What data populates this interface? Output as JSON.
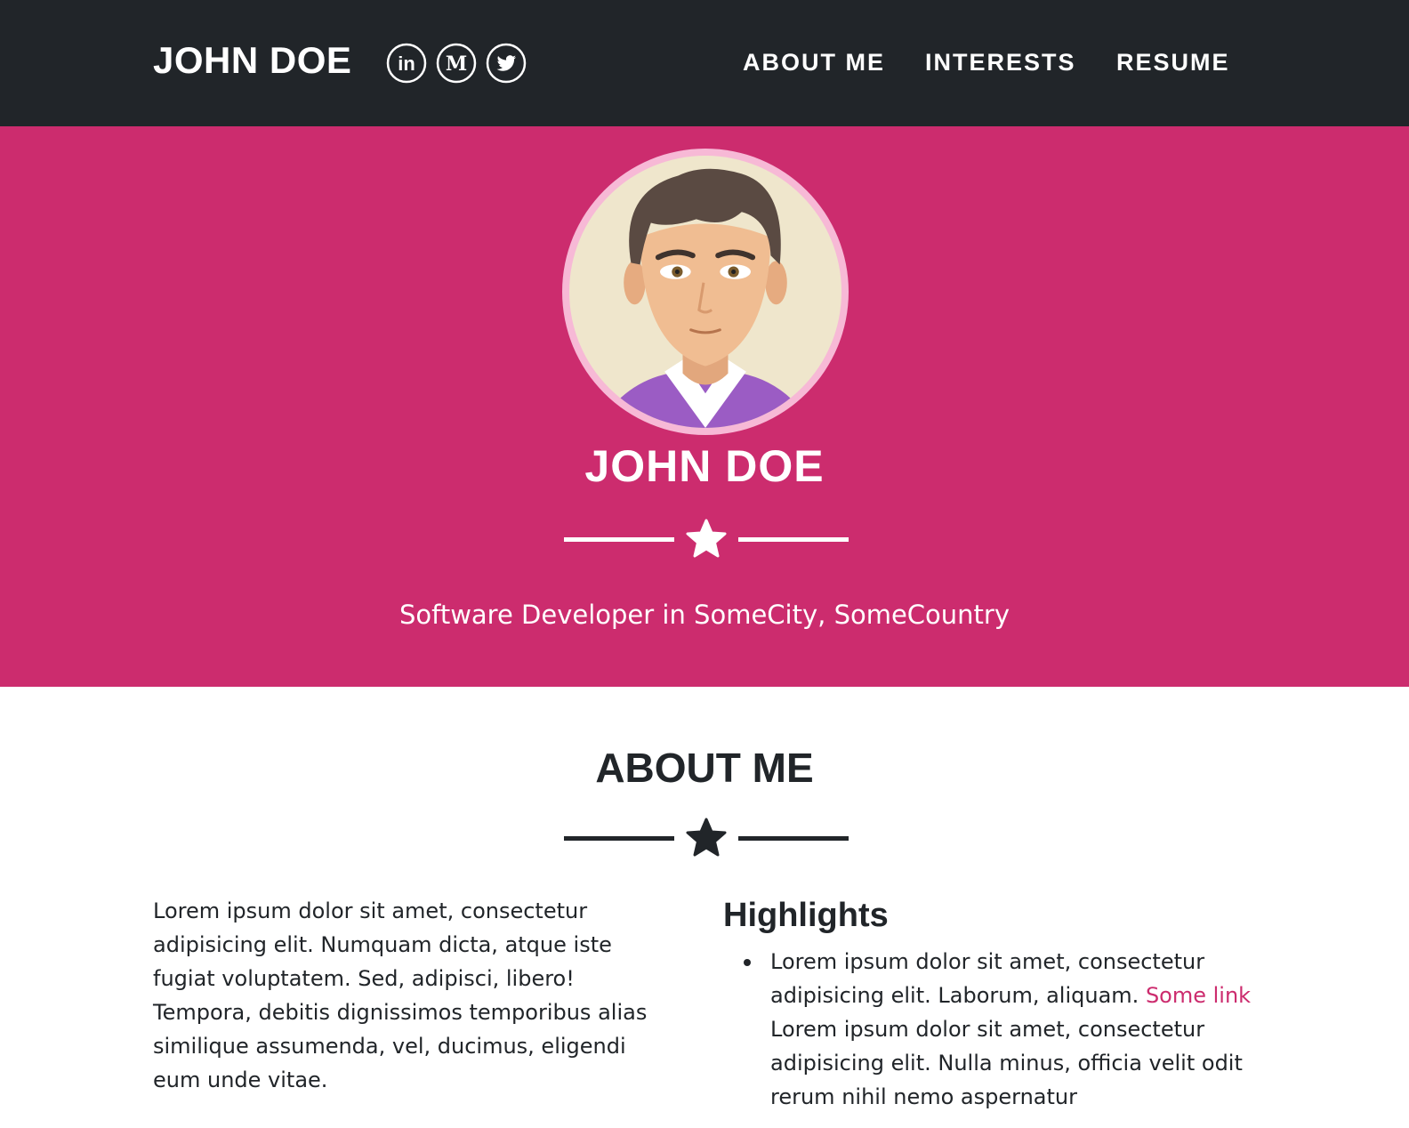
{
  "navbar": {
    "brand": "JOHN DOE",
    "social": [
      {
        "name": "linkedin",
        "icon": "linkedin-icon",
        "glyph": "in"
      },
      {
        "name": "medium",
        "icon": "medium-icon",
        "glyph": "M"
      },
      {
        "name": "twitter",
        "icon": "twitter-icon"
      }
    ],
    "links": [
      "ABOUT ME",
      "INTERESTS",
      "RESUME"
    ]
  },
  "hero": {
    "avatar_icon": "avatar-illustration",
    "name": "JOHN DOE",
    "divider_icon": "star-icon",
    "tagline": "Software Developer in SomeCity, SomeCountry"
  },
  "about": {
    "title": "ABOUT ME",
    "divider_icon": "star-icon",
    "text": "Lorem ipsum dolor sit amet, consectetur adipisicing elit. Numquam dicta, atque iste fugiat voluptatem. Sed, adipisci, libero! Tempora, debitis dignissimos temporibus alias similique assumenda, vel, ducimus, eligendi eum unde vitae.",
    "highlights_title": "Highlights",
    "highlight_1_before": "Lorem ipsum dolor sit amet, consectetur adipisicing elit. Laborum, aliquam. ",
    "highlight_1_link": "Some link",
    "highlight_1_after": " Lorem ipsum dolor sit amet, consectetur adipisicing elit. Nulla minus, officia velit odit rerum nihil nemo aspernatur"
  },
  "colors": {
    "navbar_bg": "#212529",
    "accent": "#cc2c6e",
    "text": "#212529",
    "avatar_ring": "#f7b9d6"
  }
}
